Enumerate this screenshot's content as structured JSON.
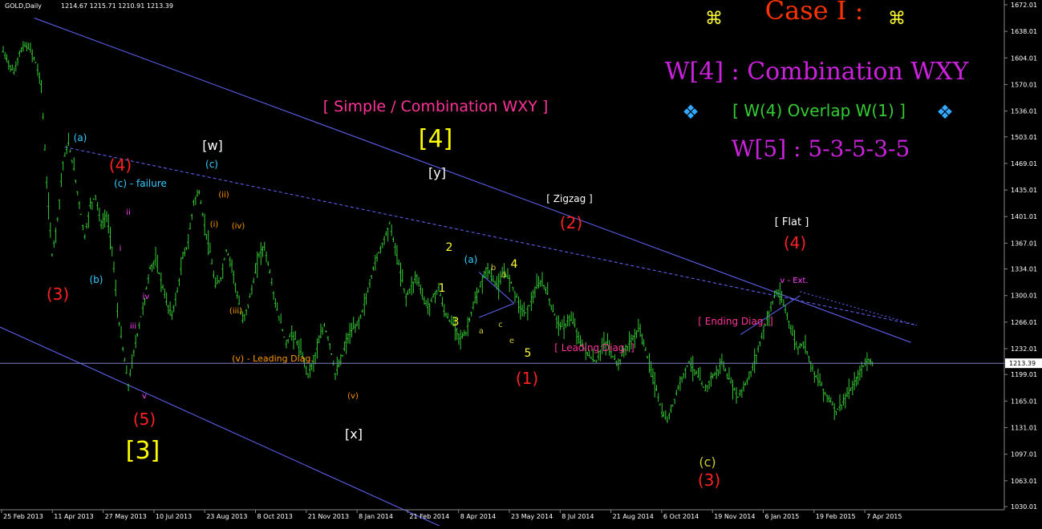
{
  "header": {
    "symbol": "GOLD,Daily",
    "ohlc": "1214.67 1215.71 1210.91 1213.39"
  },
  "colors": {
    "background": "#000000",
    "candle": "#33cc33",
    "trendline": "#6666ff",
    "current_price_line": "#8080c0",
    "price_label_bg": "#ffffff"
  },
  "headline": {
    "case_title": "Case I :",
    "case_sym_left": "⌘",
    "case_sym_right": "⌘",
    "w4": "W[4] : Combination WXY",
    "overlap": "[ W(4) Overlap W(1) ]",
    "diamond_left": "❖",
    "diamond_right": "❖",
    "w5": "W[5] : 5-3-5-3-5",
    "simple_combo": "[ Simple / Combination WXY ]"
  },
  "chart_data": {
    "type": "candlestick",
    "title": "GOLD,Daily",
    "current_price": 1213.39,
    "ylim": [
      1028,
      1674
    ],
    "y_ticks": [
      "1672.01",
      "1638.01",
      "1604.01",
      "1570.01",
      "1536.01",
      "1503.01",
      "1469.01",
      "1435.01",
      "1401.01",
      "1367.01",
      "1334.01",
      "1300.01",
      "1266.01",
      "1232.01",
      "1199.01",
      "1165.01",
      "1131.01",
      "1097.01",
      "1063.01",
      "1030.01"
    ],
    "x_ticks": [
      "25 Feb 2013",
      "11 Apr 2013",
      "27 May 2013",
      "10 Jul 2013",
      "23 Aug 2013",
      "8 Oct 2013",
      "21 Nov 2013",
      "8 Jan 2014",
      "21 Feb 2014",
      "8 Apr 2014",
      "23 May 2014",
      "8 Jul 2014",
      "21 Aug 2014",
      "6 Oct 2014",
      "19 Nov 2014",
      "6 Jan 2015",
      "19 Feb 2015",
      "7 Apr 2015"
    ],
    "price_path": [
      1612,
      1598,
      1585,
      1610,
      1620,
      1615,
      1598,
      1570,
      1445,
      1352,
      1398,
      1470,
      1495,
      1462,
      1418,
      1375,
      1415,
      1428,
      1390,
      1402,
      1362,
      1280,
      1232,
      1185,
      1228,
      1262,
      1295,
      1335,
      1345,
      1320,
      1292,
      1275,
      1305,
      1348,
      1368,
      1420,
      1432,
      1390,
      1355,
      1312,
      1322,
      1358,
      1340,
      1300,
      1268,
      1288,
      1318,
      1352,
      1362,
      1330,
      1290,
      1265,
      1238,
      1252,
      1240,
      1222,
      1200,
      1215,
      1240,
      1262,
      1238,
      1200,
      1215,
      1240,
      1255,
      1262,
      1280,
      1305,
      1335,
      1355,
      1372,
      1392,
      1362,
      1330,
      1298,
      1312,
      1325,
      1300,
      1285,
      1298,
      1310,
      1280,
      1268,
      1262,
      1245,
      1252,
      1278,
      1298,
      1318,
      1335,
      1320,
      1312,
      1330,
      1322,
      1305,
      1285,
      1278,
      1292,
      1310,
      1318,
      1302,
      1280,
      1265,
      1258,
      1272,
      1262,
      1240,
      1230,
      1220,
      1215,
      1235,
      1240,
      1222,
      1212,
      1228,
      1238,
      1248,
      1258,
      1230,
      1205,
      1180,
      1150,
      1140,
      1160,
      1182,
      1200,
      1215,
      1205,
      1192,
      1178,
      1195,
      1200,
      1215,
      1198,
      1185,
      1170,
      1182,
      1195,
      1215,
      1240,
      1262,
      1285,
      1305,
      1295,
      1275,
      1250,
      1232,
      1240,
      1222,
      1200,
      1190,
      1175,
      1165,
      1152,
      1160,
      1172,
      1182,
      1195,
      1210,
      1218,
      1213
    ],
    "trendlines": [
      {
        "from": [
          "2013-03-25",
          1655
        ],
        "to": [
          "2015-04-15",
          1240
        ],
        "style": "solid"
      },
      {
        "from": [
          "2013-02-01",
          1275
        ],
        "to": [
          "2014-03-15",
          1000
        ],
        "style": "solid"
      },
      {
        "from": [
          "2013-04-20",
          1490
        ],
        "to": [
          "2015-04-20",
          1262
        ],
        "style": "dashed"
      },
      {
        "from": [
          "2015-01-10",
          1305
        ],
        "to": [
          "2015-04-20",
          1262
        ],
        "style": "dotted"
      },
      {
        "from": [
          "2014-04-10",
          1330
        ],
        "to": [
          "2014-05-10",
          1290
        ],
        "style": "solid"
      },
      {
        "from": [
          "2014-04-10",
          1272
        ],
        "to": [
          "2014-05-10",
          1290
        ],
        "style": "solid"
      },
      {
        "from": [
          "2014-11-20",
          1250
        ],
        "to": [
          "2015-01-10",
          1300
        ],
        "style": "solid"
      }
    ],
    "annotations": [
      {
        "text": "(a)",
        "color": "#33ccff"
      },
      {
        "text": "(4)",
        "color": "#ff2222"
      },
      {
        "text": "(c) - failure",
        "color": "#33ccff"
      },
      {
        "text": "(3)",
        "color": "#ff2222"
      },
      {
        "text": "(b)",
        "color": "#33ccff"
      },
      {
        "text": "ii",
        "color": "#ff44ff"
      },
      {
        "text": "i",
        "color": "#ff44ff"
      },
      {
        "text": "iii",
        "color": "#ff44ff"
      },
      {
        "text": "iv",
        "color": "#ff44ff"
      },
      {
        "text": "v",
        "color": "#ff44ff"
      },
      {
        "text": "(5)",
        "color": "#ff2222"
      },
      {
        "text": "[3]",
        "color": "#ffff00"
      },
      {
        "text": "[w]",
        "color": "#ffffff"
      },
      {
        "text": "(c)",
        "color": "#33ccff"
      },
      {
        "text": "(ii)",
        "color": "#ff9900"
      },
      {
        "text": "(i)",
        "color": "#ff9900"
      },
      {
        "text": "(iv)",
        "color": "#ff9900"
      },
      {
        "text": "(iii)",
        "color": "#ff9900"
      },
      {
        "text": "(v) - Leading Diag.",
        "color": "#ff9900"
      },
      {
        "text": "(v)",
        "color": "#ff9900"
      },
      {
        "text": "[x]",
        "color": "#ffffff"
      },
      {
        "text": "[4]",
        "color": "#ffff00"
      },
      {
        "text": "[y]",
        "color": "#ffffff"
      },
      {
        "text": "(a)",
        "color": "#33ccff"
      },
      {
        "text": "a",
        "color": "#cccc33"
      },
      {
        "text": "b",
        "color": "#cccc33"
      },
      {
        "text": "c",
        "color": "#cccc33"
      },
      {
        "text": "d",
        "color": "#cccc33"
      },
      {
        "text": "e",
        "color": "#cccc33"
      },
      {
        "text": "1",
        "color": "#ffff33"
      },
      {
        "text": "2",
        "color": "#ffff33"
      },
      {
        "text": "3",
        "color": "#ffff33"
      },
      {
        "text": "4",
        "color": "#ffff33"
      },
      {
        "text": "5",
        "color": "#ffff33"
      },
      {
        "text": "[ Zigzag ]",
        "color": "#ffffff"
      },
      {
        "text": "(2)",
        "color": "#ff2222"
      },
      {
        "text": "(1)",
        "color": "#ff2222"
      },
      {
        "text": "[ Leading Diag. ]",
        "color": "#ff3399"
      },
      {
        "text": "[ Ending Diag. ]",
        "color": "#ff3399"
      },
      {
        "text": "[ Flat ]",
        "color": "#ffffff"
      },
      {
        "text": "v - Ext.",
        "color": "#ff44ff"
      },
      {
        "text": "(c)",
        "color": "#cccc33"
      },
      {
        "text": "(3)",
        "color": "#ff2222"
      },
      {
        "text": "(4)",
        "color": "#ff2222"
      }
    ]
  }
}
